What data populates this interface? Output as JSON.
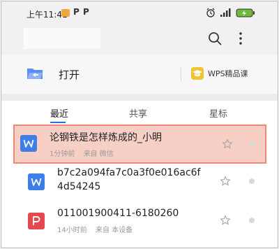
{
  "status_bar": {
    "time": "上午11:41",
    "icons": [
      "notification-icon",
      "p-app-icon",
      "p-app-icon",
      "alarm-icon",
      "signal-4g-icon",
      "battery-charging-icon"
    ]
  },
  "header": {
    "search_icon": "search-icon",
    "more_icon": "more-vertical-icon"
  },
  "quick_actions": {
    "open_label": "打开",
    "course_label": "WPS精品课"
  },
  "tabs": [
    {
      "label": "最近",
      "active": true
    },
    {
      "label": "共享",
      "active": false
    },
    {
      "label": "星标",
      "active": false
    }
  ],
  "files": [
    {
      "title": "论钢铁是怎样炼成的_小明",
      "time": "1分钟前",
      "source": "来自 微信",
      "type": "word",
      "highlighted": true
    },
    {
      "title_line1": "b7c2a094fa7c0a3f0e016ac6f",
      "title_line2": "4d54245",
      "type": "word",
      "highlighted": false
    },
    {
      "title": "011001900411-6180260",
      "time": "14小时前",
      "source": "来自 本设备",
      "type": "pdf",
      "highlighted": false
    }
  ],
  "colors": {
    "accent": "#2b6fe0",
    "word_icon": "#3d7ee8",
    "pdf_icon": "#e5484d",
    "highlight_fill": "#f8cfc4",
    "highlight_border": "#ec8a72",
    "course_icon": "#f1c233"
  }
}
